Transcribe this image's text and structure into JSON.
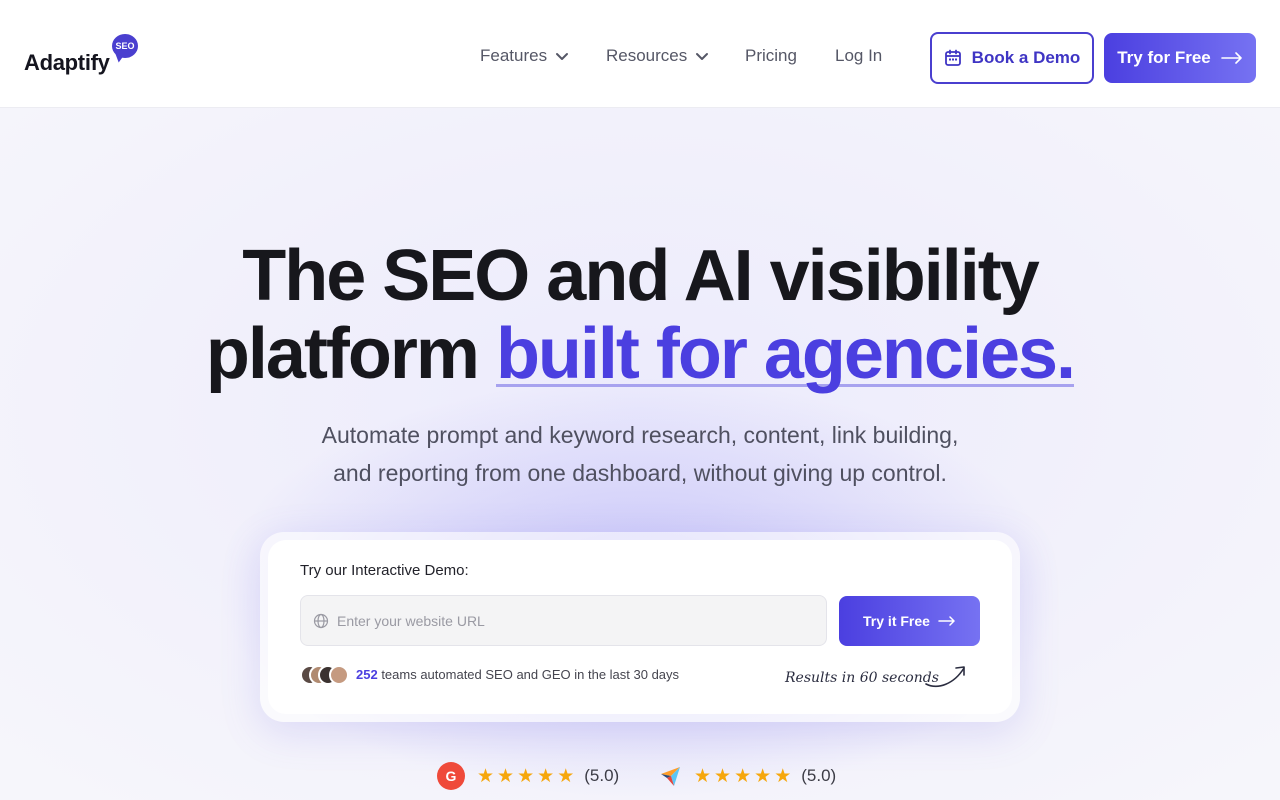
{
  "header": {
    "logo_text": "Adaptify",
    "logo_badge": "SEO",
    "nav": [
      {
        "label": "Features"
      },
      {
        "label": "Resources"
      },
      {
        "label": "Pricing"
      },
      {
        "label": "Log In"
      }
    ],
    "book_demo_label": "Book a Demo",
    "try_free_label": "Try for Free"
  },
  "hero": {
    "headline_line1": "The SEO and AI visibility",
    "headline_line2_prefix": "platform ",
    "headline_accent": "built for agencies.",
    "subtitle_line1": "Automate prompt and keyword research, content, link building,",
    "subtitle_line2": "and reporting from one dashboard, without giving up control."
  },
  "demo": {
    "title": "Try our Interactive Demo:",
    "url_placeholder": "Enter your website URL",
    "button_label": "Try it Free",
    "teams_count": "252",
    "teams_text": " teams automated SEO and GEO in the last 30 days",
    "results_note": "Results in 60 seconds"
  },
  "ratings": [
    {
      "source_icon": "g2-logo-icon",
      "stars": 5,
      "score": "(5.0)"
    },
    {
      "source_icon": "capterra-logo-icon",
      "stars": 5,
      "score": "(5.0)"
    }
  ],
  "colors": {
    "accent": "#4b3fe0",
    "star": "#f6a70c",
    "g2_red": "#ef4a3a"
  }
}
